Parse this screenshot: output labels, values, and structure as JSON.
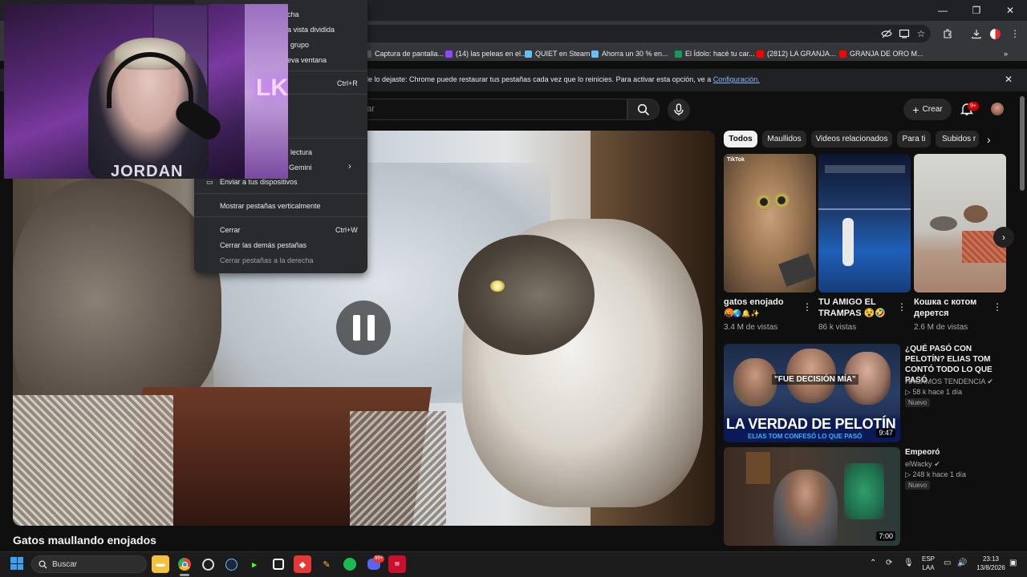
{
  "chrome": {
    "window_controls": [
      "—",
      "❐",
      "✕"
    ],
    "bookmarks": [
      {
        "label": "Captura de pantalla...",
        "color": "#5f6368"
      },
      {
        "label": "(14) las peleas en el...",
        "color": "#9146ff"
      },
      {
        "label": "QUIET en Steam",
        "color": "#1b2838"
      },
      {
        "label": "Ahorra un 30 % en...",
        "color": "#1b2838"
      },
      {
        "label": "El Ídolo: hacé tu car...",
        "color": "#0f9d58"
      },
      {
        "label": "(2812) LA GRANJA...",
        "color": "#ff0000"
      },
      {
        "label": "GRANJA DE ORO M...",
        "color": "#ff0000"
      }
    ],
    "bookmarks_more": "»",
    "infobar": {
      "text": "le lo dejaste: Chrome puede restaurar tus pestañas cada vez que lo reinicies. Para activar esta opción, ve a",
      "link": "Configuración.",
      "close": "✕"
    }
  },
  "menu": {
    "items": [
      {
        "label": "cha"
      },
      {
        "label": "a vista dividida"
      },
      {
        "label": "grupo"
      },
      {
        "label": "eva ventana"
      },
      {
        "label": "Ctrl+R",
        "shortcut_only": true
      },
      {
        "label": "lectura"
      },
      {
        "label": "Gemini",
        "chevron": "›"
      },
      {
        "label": "Enviar a tus dispositivos"
      },
      {
        "label": "Mostrar pestañas verticalmente"
      },
      {
        "label": "Cerrar",
        "shortcut": "Ctrl+W"
      },
      {
        "label": "Cerrar las demás pestañas"
      },
      {
        "label": "Cerrar pestañas a la derecha",
        "disabled": true
      }
    ]
  },
  "youtube": {
    "search_placeholder": "ar",
    "create_label": "Crear",
    "notifications_badge": "9+",
    "video_title": "Gatos maullando enojados",
    "chips": [
      "Todos",
      "Maullidos",
      "Videos relacionados",
      "Para ti",
      "Subidos r"
    ],
    "shorts": [
      {
        "title": "gatos enojado 😡",
        "emoji": "🤬🌏🔔✨",
        "views": "3.4 M de vistas",
        "label": "TikTok"
      },
      {
        "title": "TU AMIGO EL TRAMPAS 😵🤣",
        "views": "86 k vistas"
      },
      {
        "title": "Кошка с котом дерется",
        "views": "2.6 M de vistas"
      }
    ],
    "recommended": [
      {
        "title": "¿QUÉ PASÓ CON PELOTÍN? ELIAS TOM CONTÓ TODO LO QUE PASÓ",
        "channel": "HAGAMOS TENDENCIA",
        "meta": "▷ 58 k   hace 1 día",
        "badge": "Nuevo",
        "duration": "9:47",
        "thumb_text": "LA VERDAD DE PELOTÍN",
        "thumb_sub": "ELIAS TOM CONFESÓ LO QUE PASÓ",
        "thumb_quote": "\"FUE DECISIÓN MÍA\""
      },
      {
        "title": "Empeoró",
        "channel": "elWacky",
        "meta": "▷ 248 k   hace 1 día",
        "badge": "Nuevo",
        "duration": "7:00"
      }
    ]
  },
  "webcam": {
    "neon": "LKZ",
    "shirt": "JORDAN"
  },
  "taskbar": {
    "search_label": "Buscar",
    "lang_top": "ESP",
    "lang_bottom": "LAA",
    "time": "23:13",
    "date": "13/8/2026",
    "discord_badge": "99+"
  },
  "colors": {
    "accent": "#3ea6ff",
    "red": "#cc0000",
    "link": "#8ab4f8"
  }
}
